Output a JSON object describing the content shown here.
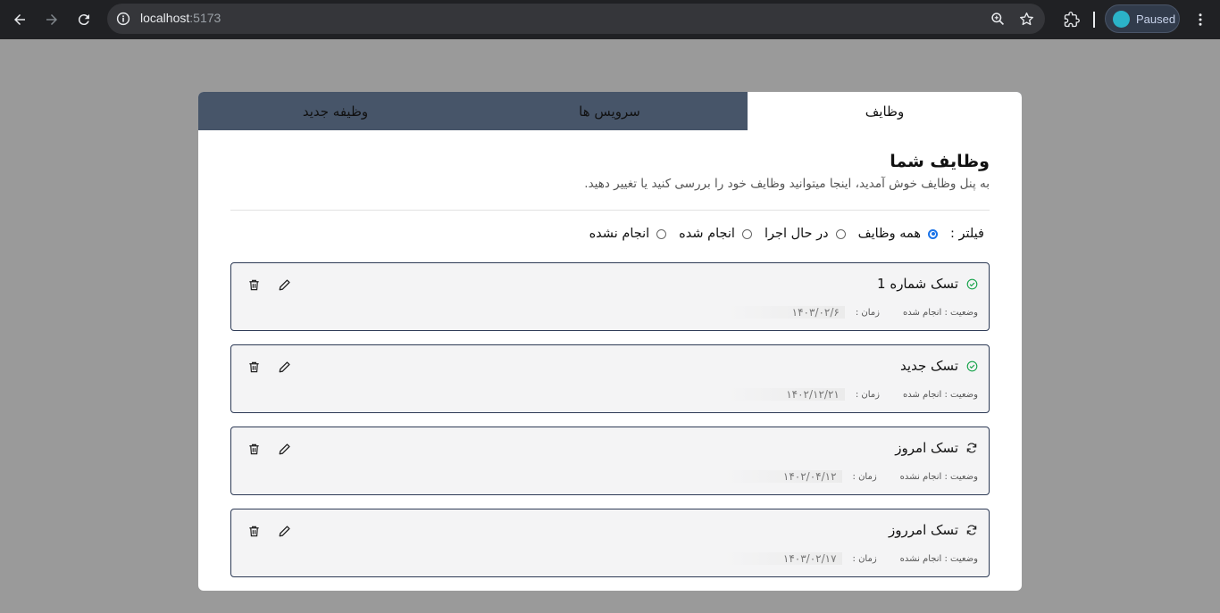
{
  "browser": {
    "url_host": "localhost",
    "url_port": ":5173",
    "profile_label": "Paused"
  },
  "tabs": [
    {
      "label": "وظایف",
      "active": true
    },
    {
      "label": "سرویس ها",
      "active": false
    },
    {
      "label": "وظیفه جدید",
      "active": false
    }
  ],
  "main": {
    "title": "وظایف شما",
    "subtitle": "به پنل وظایف خوش آمدید، اینجا میتوانید وظایف خود را بررسی کنید یا تغییر دهید."
  },
  "filter": {
    "label": "فیلتر :",
    "options": [
      {
        "label": "همه وظایف",
        "checked": true
      },
      {
        "label": "در حال اجرا",
        "checked": false
      },
      {
        "label": "انجام شده",
        "checked": false
      },
      {
        "label": "انجام نشده",
        "checked": false
      }
    ]
  },
  "tasks": [
    {
      "name": "تسک شماره 1",
      "status_icon": "check-circle-icon",
      "status": "وضعیت : انجام شده",
      "time_label": "زمان :",
      "date": "۱۴۰۳/۰۲/۶"
    },
    {
      "name": "تسک جدید",
      "status_icon": "check-circle-icon",
      "status": "وضعیت : انجام شده",
      "time_label": "زمان :",
      "date": "۱۴۰۲/۱۲/۲۱"
    },
    {
      "name": "تسک امروز",
      "status_icon": "refresh-icon",
      "status": "وضعیت : انجام نشده",
      "time_label": "زمان :",
      "date": "۱۴۰۲/۰۴/۱۲"
    },
    {
      "name": "تسک امرروز",
      "status_icon": "refresh-icon",
      "status": "وضعیت : انجام نشده",
      "time_label": "زمان :",
      "date": "۱۴۰۳/۰۲/۱۷"
    }
  ],
  "colors": {
    "tab_bar": "#475569",
    "task_border": "#2d3a55",
    "done_icon": "#16a34a",
    "radio_accent": "#1a73e8"
  }
}
